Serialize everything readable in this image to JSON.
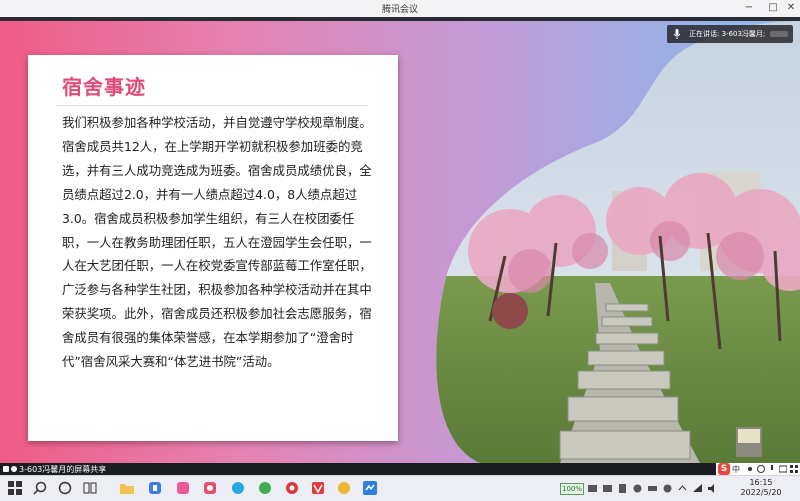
{
  "window": {
    "title": "腾讯会议",
    "minimize_glyph": "−",
    "maximize_glyph": "□",
    "close_glyph": "✕"
  },
  "slide": {
    "heading": "宿舍事迹",
    "body": "我们积极参加各种学校活动，并自觉遵守学校规章制度。宿舍成员共12人，在上学期开学初就积极参加班委的竞选，并有三人成功竞选成为班委。宿舍成员成绩优良，全员绩点超过2.0，并有一人绩点超过4.0，8人绩点超过3.0。宿舍成员积极参加学生组织，有三人在校团委任职，一人在教务助理团任职，五人在澄园学生会任职，一人在大艺团任职，一人在校党委宣传部蓝莓工作室任职，广泛参与各种学生社团，积极参加各种学校活动并在其中荣获奖项。此外，宿舍成员还积极参加社会志愿服务，宿舍成员有很强的集体荣誉感，在本学期参加了“澄舍时代”宿舍风采大赛和“体艺进书院”活动。",
    "colors": {
      "heading": "#e24b77",
      "gradient_start": "#ee5b86",
      "gradient_end": "#8fc0ea"
    }
  },
  "meeting": {
    "speaker_label": "正在讲话: 3-603冯馨月;",
    "share_status": "3-603冯馨月的屏幕共享"
  },
  "ime": {
    "logo": "S",
    "mode": "中"
  },
  "taskbar": {
    "icons": [
      "start-icon",
      "search-icon",
      "cortana-icon",
      "task-view-icon",
      "file-explorer-icon",
      "edge-browser-icon",
      "app-pink-icon",
      "app-blue-icon",
      "wechat-icon",
      "netease-music-icon",
      "wps-icon",
      "app-yellow-icon",
      "tencent-meeting-icon"
    ],
    "zoom": "100%",
    "time": "16:15",
    "date": "2022/5/20"
  }
}
